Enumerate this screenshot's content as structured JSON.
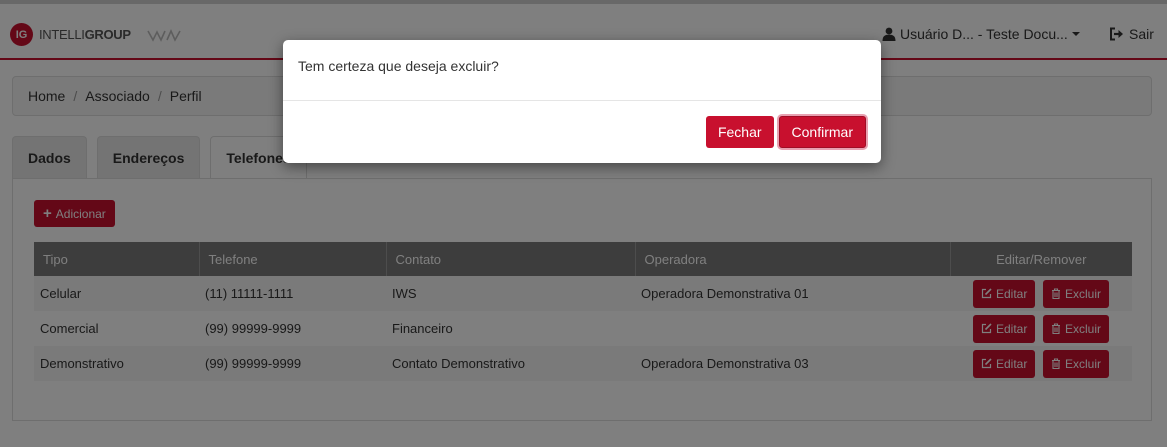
{
  "brand": {
    "badge": "IG",
    "name_light": "INTELLI",
    "name_bold": "GROUP",
    "accent": "#c8102e"
  },
  "navbar": {
    "user_label": "Usuário D... - Teste Docu...",
    "logout_label": "Sair"
  },
  "breadcrumb": [
    "Home",
    "Associado",
    "Perfil"
  ],
  "tabs": [
    {
      "label": "Dados",
      "active": false
    },
    {
      "label": "Endereços",
      "active": false
    },
    {
      "label": "Telefones",
      "active": true
    }
  ],
  "toolbar": {
    "add_label": "Adicionar"
  },
  "table": {
    "columns": [
      "Tipo",
      "Telefone",
      "Contato",
      "Operadora",
      "Editar/Remover"
    ],
    "rows": [
      {
        "tipo": "Celular",
        "telefone": "(11) 11111-1111",
        "contato": "IWS",
        "operadora": "Operadora Demonstrativa 01"
      },
      {
        "tipo": "Comercial",
        "telefone": "(99) 99999-9999",
        "contato": "Financeiro",
        "operadora": ""
      },
      {
        "tipo": "Demonstrativo",
        "telefone": "(99) 99999-9999",
        "contato": "Contato Demonstrativo",
        "operadora": "Operadora Demonstrativa 03"
      }
    ],
    "edit_label": "Editar",
    "delete_label": "Excluir"
  },
  "modal": {
    "message": "Tem certeza que deseja excluir?",
    "close_label": "Fechar",
    "confirm_label": "Confirmar"
  }
}
